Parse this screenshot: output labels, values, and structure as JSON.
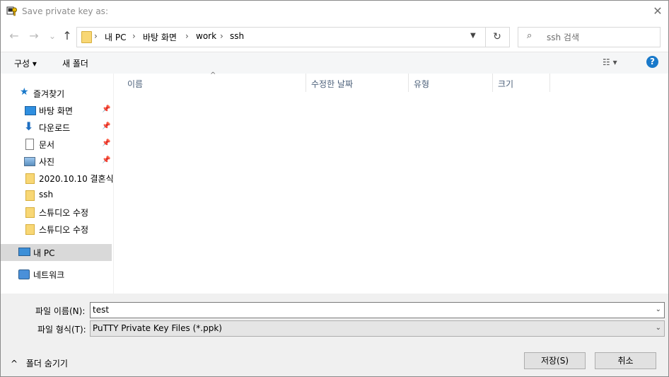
{
  "window": {
    "title": "Save private key as:"
  },
  "nav": {
    "back": "←",
    "forward": "→",
    "recent": "⌄",
    "up": "↑",
    "breadcrumbs": [
      "내 PC",
      "바탕 화면",
      "work",
      "ssh"
    ],
    "search_placeholder": "ssh 검색"
  },
  "toolbar": {
    "organize": "구성 ▾",
    "new_folder": "새 폴더",
    "view": "☷ ▾",
    "help": "?"
  },
  "sidebar": {
    "quick_access": "즐겨찾기",
    "items": [
      {
        "label": "바탕 화면",
        "icon": "desktop-icon",
        "pinned": true
      },
      {
        "label": "다운로드",
        "icon": "download-icon",
        "pinned": true
      },
      {
        "label": "문서",
        "icon": "document-icon",
        "pinned": true
      },
      {
        "label": "사진",
        "icon": "pictures-icon",
        "pinned": true
      },
      {
        "label": "2020.10.10 결혼식",
        "icon": "folder-icon",
        "pinned": false
      },
      {
        "label": "ssh",
        "icon": "folder-icon",
        "pinned": false
      },
      {
        "label": "스튜디오 수정",
        "icon": "folder-icon",
        "pinned": false
      },
      {
        "label": "스튜디오 수정",
        "icon": "folder-icon",
        "pinned": false
      }
    ],
    "this_pc": "내 PC",
    "network": "네트워크"
  },
  "columns": [
    "이름",
    "수정한 날짜",
    "유형",
    "크기"
  ],
  "form": {
    "filename_label": "파일 이름(N):",
    "filename_value": "test",
    "filetype_label": "파일 형식(T):",
    "filetype_value": "PuTTY Private Key Files (*.ppk)",
    "save_label": "저장(S)",
    "cancel_label": "취소",
    "hide_folders": "폴더 숨기기"
  },
  "colors": {
    "accent": "#1979ca",
    "folder": "#f8d775",
    "selected": "#d9d9d9",
    "panel": "#f0f0f0"
  }
}
